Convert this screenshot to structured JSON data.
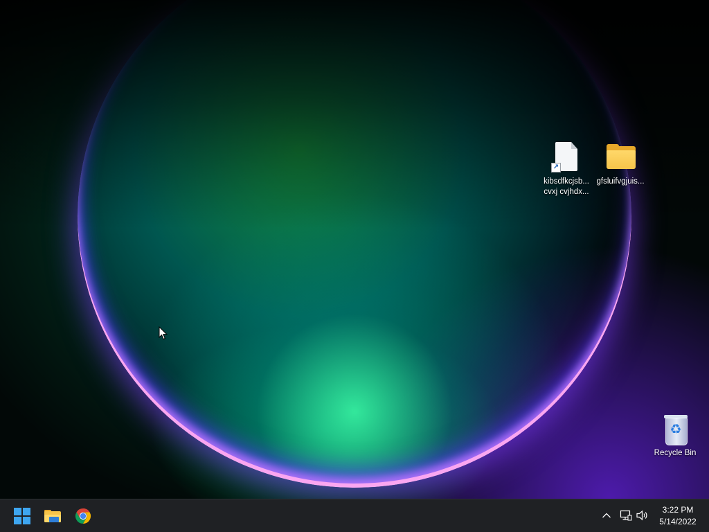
{
  "desktop": {
    "icons": [
      {
        "name": "shortcut-file",
        "label": "kibsdfkcjsb...\ncvxj cvjhdx...",
        "type": "file-shortcut-icon"
      },
      {
        "name": "folder",
        "label": "gfsluifvgjuis...",
        "type": "folder-icon"
      },
      {
        "name": "recycle-bin",
        "label": "Recycle Bin",
        "type": "recycle-bin-icon"
      }
    ]
  },
  "taskbar": {
    "pinned": [
      {
        "name": "start",
        "icon": "windows-start-icon"
      },
      {
        "name": "file-explorer",
        "icon": "file-explorer-icon"
      },
      {
        "name": "chrome",
        "icon": "chrome-icon"
      }
    ],
    "tray": {
      "icons": [
        "chevron-up-icon",
        "network-icon",
        "volume-icon"
      ],
      "time": "3:22 PM",
      "date": "5/14/2022"
    },
    "colors": {
      "background": "#1f2124",
      "accent": "#3ea6f0"
    }
  }
}
